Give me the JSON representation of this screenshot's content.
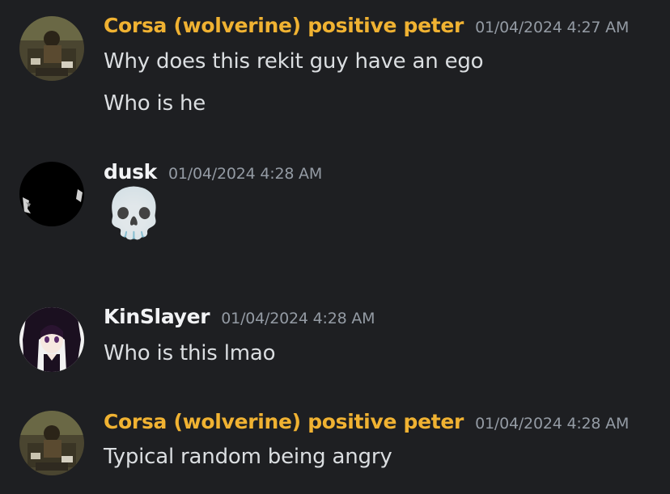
{
  "colors": {
    "background": "#1e1f22",
    "highlighted_name": "#f0b232",
    "default_name": "#f2f3f5",
    "timestamp": "#949ba4",
    "message_text": "#dbdee1"
  },
  "messages": [
    {
      "author": "Corsa (wolverine) positive peter",
      "timestamp": "01/04/2024 4:27 AM",
      "lines": [
        "Why does this rekit guy have an ego",
        "Who is he"
      ]
    },
    {
      "author": "dusk",
      "timestamp": "01/04/2024 4:28 AM",
      "emoji": "💀",
      "emoji_name": "skull-emoji"
    },
    {
      "author": "KinSlayer",
      "timestamp": "01/04/2024 4:28 AM",
      "lines": [
        "Who is this lmao"
      ]
    },
    {
      "author": "Corsa (wolverine) positive peter",
      "timestamp": "01/04/2024 4:28 AM",
      "lines": [
        "Typical random being angry"
      ]
    }
  ]
}
